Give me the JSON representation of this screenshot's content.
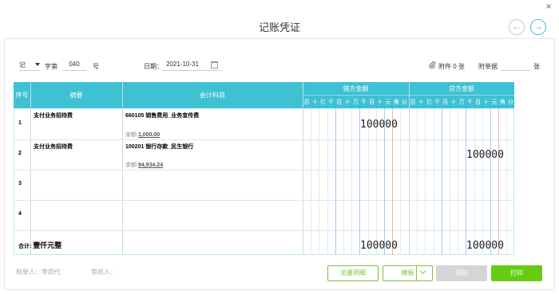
{
  "dialog": {
    "title": "记账凭证",
    "close_icon": "×",
    "prev_icon": "←",
    "next_icon": "→"
  },
  "toolbar": {
    "voucher_word": "记",
    "word_label": "字第",
    "voucher_no": "040",
    "no_label": "号",
    "date_label": "日期：",
    "date_value": "2021-10-31",
    "attachment_label": "附件",
    "attachment_count": "0",
    "attachment_unit": "张",
    "attach_doc_label": "附单据",
    "attach_doc_value": "",
    "attach_doc_unit": "张"
  },
  "table": {
    "headers": {
      "seq": "序号",
      "summary": "摘要",
      "account": "会计科目",
      "debit": "借方金额",
      "credit": "贷方金额"
    },
    "digit_labels": [
      "百",
      "十",
      "亿",
      "千",
      "百",
      "十",
      "万",
      "千",
      "百",
      "十",
      "元",
      "角",
      "分"
    ],
    "rows": [
      {
        "seq": "1",
        "summary": "支付业务招待费",
        "account": "660105 销售费用_业务宣传费",
        "balance_label": "余额:",
        "balance_value": "1,000.00",
        "debit": "100000",
        "credit": ""
      },
      {
        "seq": "2",
        "summary": "支付业务招待费",
        "account": "100201 银行存款_民生银行",
        "balance_label": "余额:",
        "balance_value": "94,934.24",
        "debit": "",
        "credit": "100000"
      },
      {
        "seq": "3",
        "summary": "",
        "account": "",
        "balance_label": "",
        "balance_value": "",
        "debit": "",
        "credit": ""
      },
      {
        "seq": "4",
        "summary": "",
        "account": "",
        "balance_label": "",
        "balance_value": "",
        "debit": "",
        "credit": ""
      }
    ],
    "total": {
      "label": "合计:",
      "amount_in_words": "壹仟元整",
      "debit": "100000",
      "credit": "100000"
    }
  },
  "footer": {
    "maker_label": "制单人：",
    "maker_name": "李四代",
    "reviewer_label": "审核人：",
    "reviewer_name": "",
    "flow_button": "流量明细",
    "template_button": "模板",
    "save_button": "保存",
    "print_button": "打印"
  },
  "colors": {
    "header_bg": "#3ec1d3",
    "accent_green": "#66cc11",
    "outline_green": "#7cc242"
  }
}
